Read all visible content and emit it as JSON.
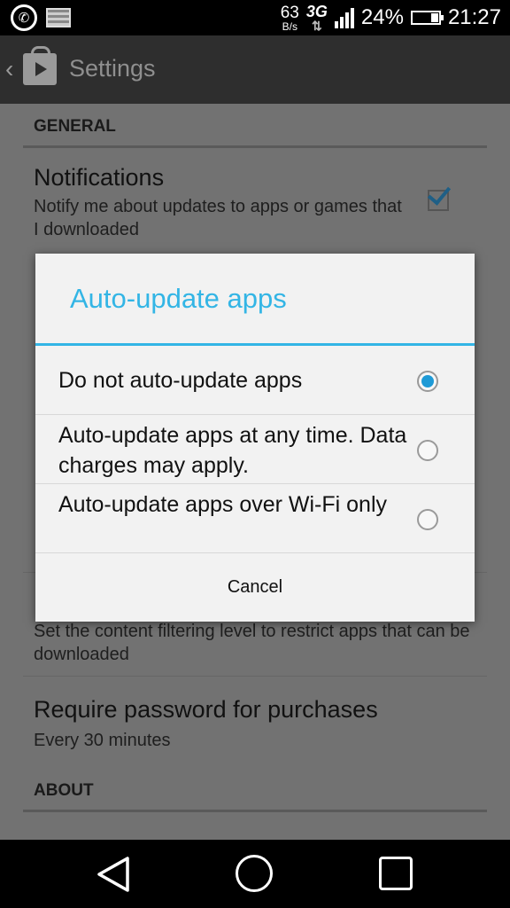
{
  "status": {
    "speed_value": "63",
    "speed_unit": "B/s",
    "network": "3G",
    "battery": "24%",
    "time": "21:27"
  },
  "appbar": {
    "title": "Settings"
  },
  "settings": {
    "general_header": "GENERAL",
    "notifications_title": "Notifications",
    "notifications_sub": "Notify me about updates to apps or games that I downloaded",
    "notifications_checked": true,
    "filter_sub": "Set the content filtering level to restrict apps that can be downloaded",
    "password_title": "Require password for purchases",
    "password_sub": "Every 30 minutes",
    "about_header": "ABOUT"
  },
  "dialog": {
    "title": "Auto-update apps",
    "options": [
      {
        "label": "Do not auto-update apps",
        "selected": true
      },
      {
        "label": "Auto-update apps at any time. Data charges may apply.",
        "selected": false
      },
      {
        "label": "Auto-update apps over Wi-Fi only",
        "selected": false
      }
    ],
    "cancel_label": "Cancel"
  },
  "colors": {
    "accent": "#33b5e5",
    "radio_selected": "#1e9ad6",
    "checkbox_tick": "#1f5f86"
  },
  "icons": [
    "whatsapp-icon",
    "image-icon",
    "signal-icon",
    "battery-icon",
    "back-chevron-icon",
    "play-store-icon",
    "checkbox-icon",
    "nav-back-icon",
    "nav-home-icon",
    "nav-recent-icon"
  ]
}
